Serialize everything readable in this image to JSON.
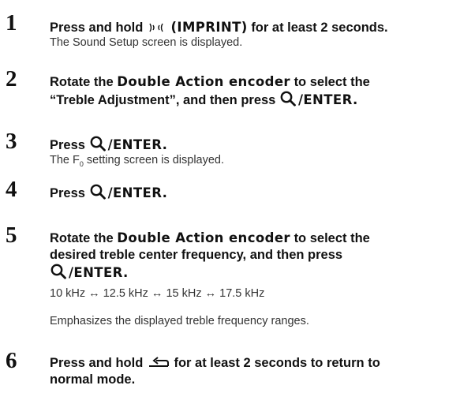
{
  "steps": [
    {
      "number": "1",
      "text_press_hold": "Press and hold",
      "imprint_label": "(IMPRINT)",
      "text_duration": "for at least 2 seconds.",
      "note": "The Sound Setup screen is displayed."
    },
    {
      "number": "2",
      "text_rotate": "Rotate the",
      "encoder_name": "Double Action encoder",
      "text_select": "to select the",
      "target": "“Treble Adjustment”, and then press",
      "enter_label": "/ENTER."
    },
    {
      "number": "3",
      "text_press": "Press",
      "enter_label": "/ENTER.",
      "note_prefix": "The F",
      "note_subscript": "0",
      "note_suffix": " setting screen is displayed."
    },
    {
      "number": "4",
      "text_press": "Press",
      "enter_label": "/ENTER."
    },
    {
      "number": "5",
      "text_rotate": "Rotate the",
      "encoder_name": "Double Action encoder",
      "text_select": "to select the",
      "line2": "desired treble center frequency, and then press",
      "enter_label": "/ENTER.",
      "frequency_cycle": "10 kHz ↔ 12.5 kHz ↔ 15 kHz ↔ 17.5 kHz",
      "note": "Emphasizes the displayed treble frequency ranges."
    },
    {
      "number": "6",
      "text_press_hold": "Press and hold",
      "text_rest": "for at least 2 seconds to return to",
      "line2": "normal mode."
    }
  ],
  "icons": {
    "imprint": "imprint-sound-icon",
    "search": "magnifier-icon",
    "back": "return-arrow-icon"
  }
}
